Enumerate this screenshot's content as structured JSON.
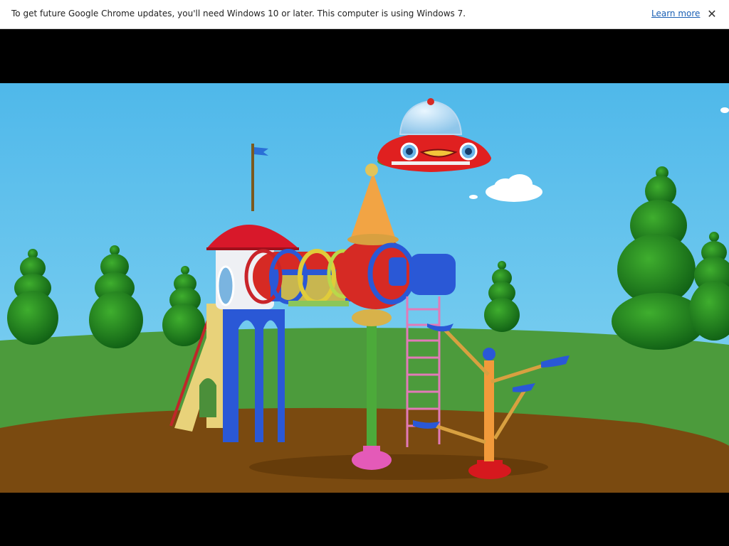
{
  "infobar": {
    "message": "To get future Google Chrome updates, you'll need Windows 10 or later. This computer is using Windows 7.",
    "learn_more": "Learn more",
    "close_icon": "close-icon"
  },
  "video": {
    "scene": "cartoon-playground-with-flying-saucer"
  },
  "colors": {
    "sky": "#5cc3ec",
    "grass": "#4a9a3a",
    "ground": "#7b4a10",
    "letterbox": "#000000",
    "link": "#1a5fb4"
  }
}
